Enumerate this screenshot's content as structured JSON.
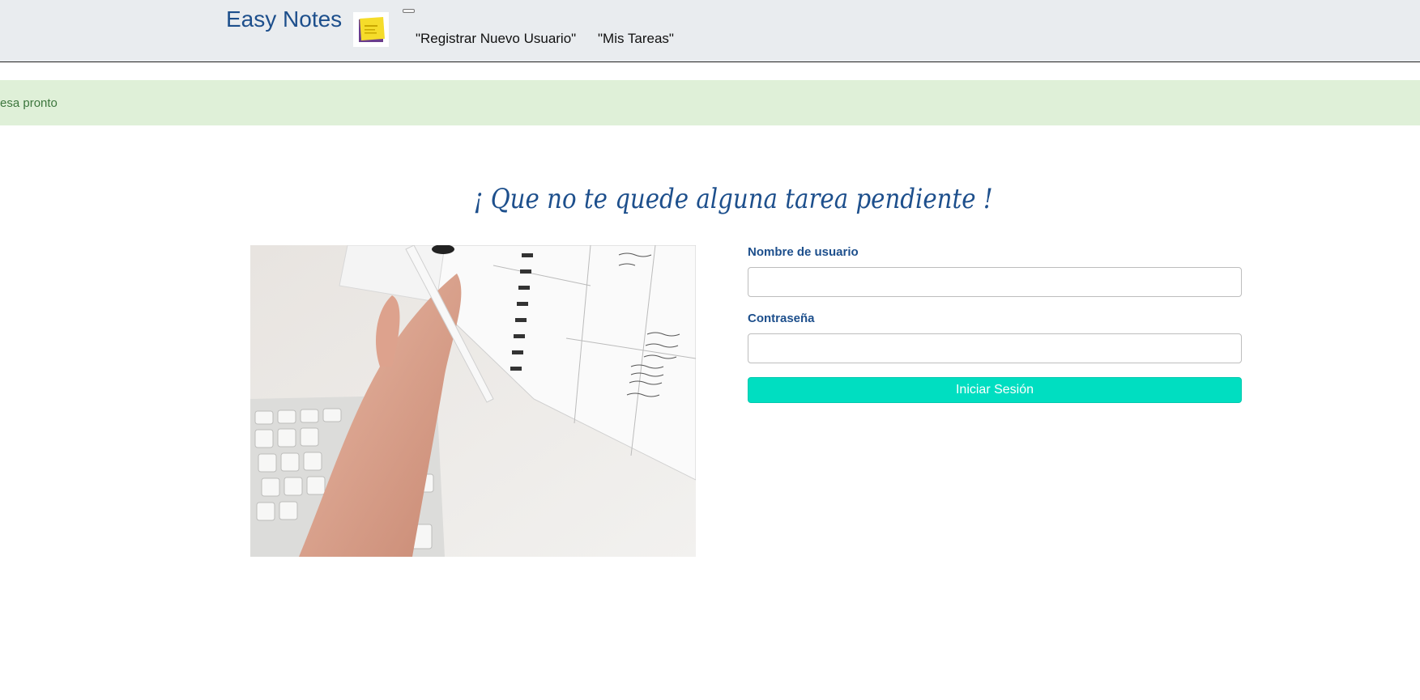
{
  "navbar": {
    "brand": "Easy Notes",
    "logo_icon": "sticky-note-logo-icon",
    "links": [
      "\"Registrar Nuevo Usuario\"",
      "\"Mis Tareas\""
    ],
    "toggler_icon": "menu-toggler-icon",
    "background": "#e9ecef"
  },
  "alert": {
    "text": "esa pronto",
    "background": "#dff0d8",
    "color": "#3c763d"
  },
  "main": {
    "headline": "¡ Que no te quede alguna tarea pendiente !",
    "image_icon": "planner-keyboard-photo"
  },
  "login": {
    "username_label": "Nombre de usuario",
    "username_value": "",
    "password_label": "Contraseña",
    "password_value": "",
    "submit_label": "Iniciar Sesión",
    "submit_color": "#00dec1"
  },
  "theme": {
    "primary": "#1d4f8c"
  }
}
